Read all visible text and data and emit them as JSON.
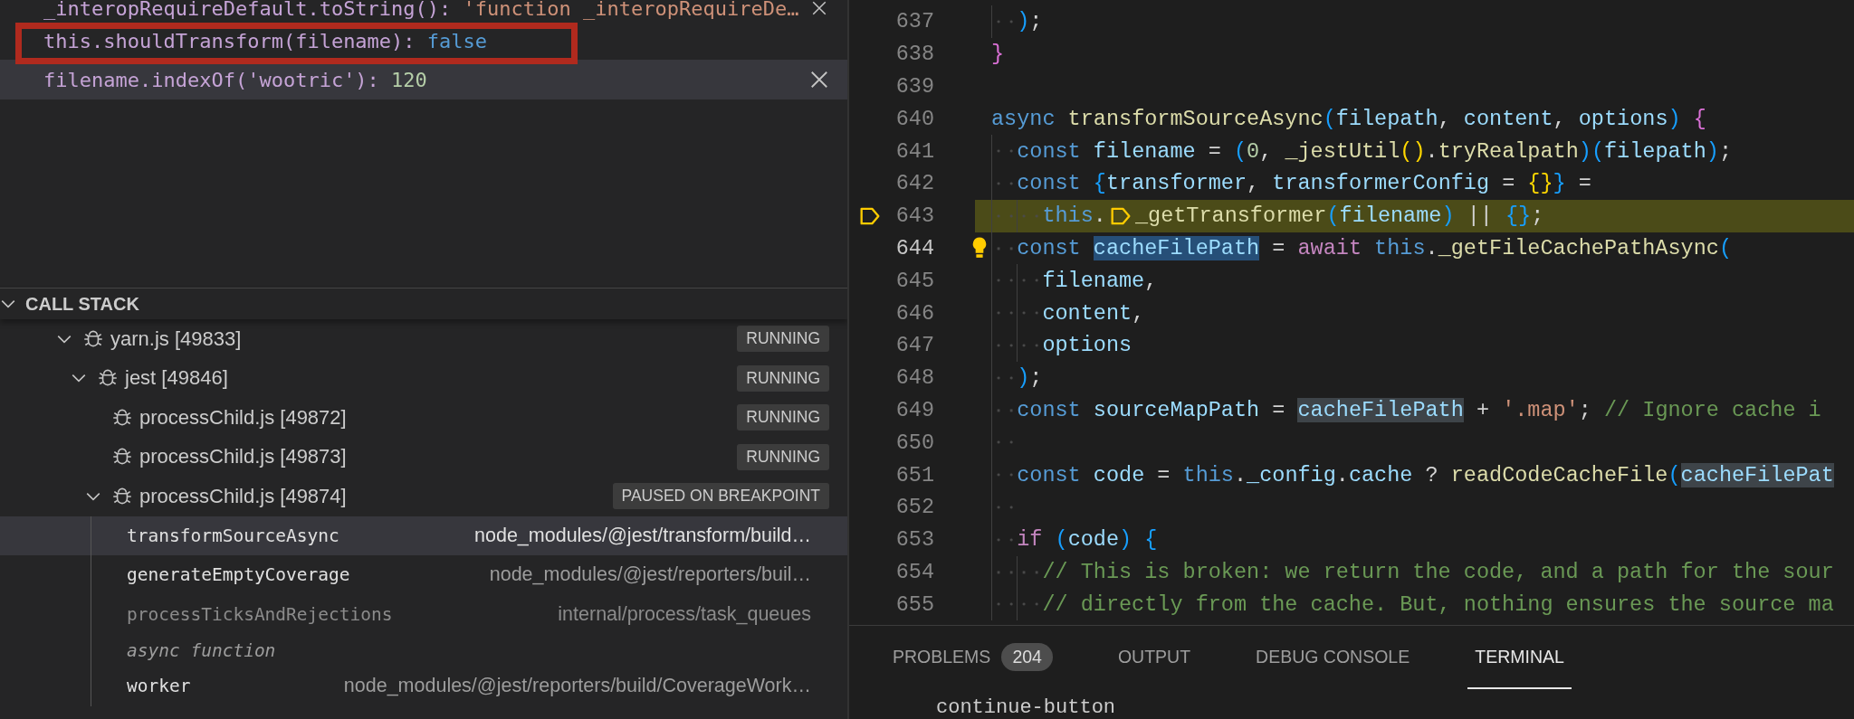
{
  "watch": {
    "annotation": {
      "kind": "outline"
    },
    "items": [
      {
        "expression": "_interopRequireDefault.toString():",
        "value": "'function _interopRequireDe…",
        "kind": "string",
        "selected": false,
        "close_button": true
      },
      {
        "expression": "this.shouldTransform(filename):",
        "value": "false",
        "kind": "boolean",
        "selected": false,
        "close_button": false
      },
      {
        "expression": "filename.indexOf('wootric'):",
        "value": "120",
        "kind": "number",
        "selected": true,
        "close_button": true
      }
    ]
  },
  "call_stack": {
    "title": "CALL STACK",
    "expanded": true,
    "items": [
      {
        "kind": "session",
        "label": "yarn.js [49833]",
        "status": "RUNNING",
        "expanded": true,
        "children": [
          {
            "kind": "session",
            "label": "jest [49846]",
            "status": "RUNNING",
            "expanded": true,
            "children": [
              {
                "kind": "session",
                "label": "processChild.js [49872]",
                "status": "RUNNING"
              },
              {
                "kind": "session",
                "label": "processChild.js [49873]",
                "status": "RUNNING"
              },
              {
                "kind": "session",
                "label": "processChild.js [49874]",
                "status": "PAUSED ON BREAKPOINT",
                "expanded": true,
                "children": [
                  {
                    "kind": "frame",
                    "name": "transformSourceAsync",
                    "source": "node_modules/@jest/transform/build…",
                    "selected": true,
                    "dimmed": false
                  },
                  {
                    "kind": "frame",
                    "name": "generateEmptyCoverage",
                    "source": "node_modules/@jest/reporters/buil…",
                    "selected": false,
                    "dimmed": false
                  },
                  {
                    "kind": "frame",
                    "name": "processTicksAndRejections",
                    "source": "internal/process/task_queues",
                    "selected": false,
                    "dimmed": true
                  },
                  {
                    "kind": "label",
                    "text": "async function"
                  },
                  {
                    "kind": "frame",
                    "name": "worker",
                    "source": "node_modules/@jest/reporters/build/CoverageWork…",
                    "selected": false,
                    "dimmed": false
                  }
                ]
              }
            ]
          }
        ]
      }
    ]
  },
  "editor": {
    "lines": [
      {
        "children": [
          {
            "number": "637",
            "kind": "code",
            "tokens": [
              {
                "kind": "b3",
                "text": ")"
              },
              {
                "kind": "op",
                "text": ";"
              }
            ]
          }
        ]
      },
      {
        "number": "638",
        "kind": "code",
        "tokens": [
          {
            "kind": "b2",
            "text": "}"
          }
        ]
      },
      {
        "number": "639",
        "kind": "code"
      },
      {
        "number": "640",
        "kind": "code",
        "tokens": [
          {
            "kind": "kw",
            "text": "async"
          },
          {
            "kind": "fn",
            "text": " transformSourceAsync"
          },
          {
            "kind": "b3",
            "text": "("
          },
          {
            "kind": "var",
            "text": "filepath"
          },
          {
            "kind": "op",
            "text": ", "
          },
          {
            "kind": "var",
            "text": "content"
          },
          {
            "kind": "op",
            "text": ", "
          },
          {
            "kind": "var",
            "text": "options"
          },
          {
            "kind": "b3",
            "text": ")"
          },
          {
            "kind": "b2",
            "text": " {"
          }
        ],
        "children": [
          {
            "number": "641",
            "kind": "code",
            "tokens": [
              {
                "kind": "kw",
                "text": "const"
              },
              {
                "kind": "var",
                "text": " filename"
              },
              {
                "kind": "op",
                "text": " = "
              },
              {
                "kind": "b3",
                "text": "("
              },
              {
                "kind": "num",
                "text": "0"
              },
              {
                "kind": "op",
                "text": ", "
              },
              {
                "kind": "fn",
                "text": "_jestUtil"
              },
              {
                "kind": "b1",
                "text": "()"
              },
              {
                "kind": "op",
                "text": "."
              },
              {
                "kind": "fn",
                "text": "tryRealpath"
              },
              {
                "kind": "b3",
                "text": ")("
              },
              {
                "kind": "var",
                "text": "filepath"
              },
              {
                "kind": "b3",
                "text": ")"
              },
              {
                "kind": "op",
                "text": ";"
              }
            ]
          },
          {
            "number": "642",
            "kind": "code",
            "tokens": [
              {
                "kind": "kw",
                "text": "const"
              },
              {
                "kind": "b3",
                "text": " {"
              },
              {
                "kind": "var",
                "text": "transformer"
              },
              {
                "kind": "op",
                "text": ", "
              },
              {
                "kind": "var",
                "text": "transformerConfig"
              },
              {
                "kind": "op",
                "text": " = "
              },
              {
                "kind": "b1",
                "text": "{}"
              },
              {
                "kind": "b3",
                "text": "}"
              },
              {
                "kind": "op",
                "text": " ="
              }
            ],
            "children": [
              {
                "number": "643",
                "kind": "paused",
                "tokens": [
                  {
                    "kind": "kw",
                    "text": "this"
                  },
                  {
                    "kind": "op",
                    "text": "."
                  },
                  {
                    "kind": "marker"
                  },
                  {
                    "kind": "fn",
                    "text": "_getTransformer"
                  },
                  {
                    "kind": "b3",
                    "text": "("
                  },
                  {
                    "kind": "var",
                    "text": "filename"
                  },
                  {
                    "kind": "b3",
                    "text": ")"
                  },
                  {
                    "kind": "op",
                    "text": " || "
                  },
                  {
                    "kind": "b3",
                    "text": "{}"
                  },
                  {
                    "kind": "op",
                    "text": ";"
                  }
                ]
              }
            ]
          },
          {
            "number": "644",
            "kind": "hint",
            "tokens": [
              {
                "kind": "kw",
                "text": "const "
              },
              {
                "kind": "selection",
                "text": "cacheFilePath"
              },
              {
                "kind": "op",
                "text": " = "
              },
              {
                "kind": "ctrl",
                "text": "await"
              },
              {
                "kind": "kw",
                "text": " this"
              },
              {
                "kind": "op",
                "text": "."
              },
              {
                "kind": "fn",
                "text": "_getFileCachePathAsync"
              },
              {
                "kind": "b3",
                "text": "("
              }
            ],
            "children": [
              {
                "number": "645",
                "kind": "code",
                "tokens": [
                  {
                    "kind": "var",
                    "text": "filename"
                  },
                  {
                    "kind": "op",
                    "text": ","
                  }
                ]
              },
              {
                "number": "646",
                "kind": "code",
                "tokens": [
                  {
                    "kind": "var",
                    "text": "content"
                  },
                  {
                    "kind": "op",
                    "text": ","
                  }
                ]
              },
              {
                "number": "647",
                "kind": "code",
                "tokens": [
                  {
                    "kind": "var",
                    "text": "options"
                  }
                ]
              }
            ]
          },
          {
            "number": "648",
            "kind": "code",
            "tokens": [
              {
                "kind": "b3",
                "text": ")"
              },
              {
                "kind": "op",
                "text": ";"
              }
            ]
          },
          {
            "number": "649",
            "kind": "code",
            "tokens": [
              {
                "kind": "kw",
                "text": "const"
              },
              {
                "kind": "var",
                "text": " sourceMapPath"
              },
              {
                "kind": "op",
                "text": " = "
              },
              {
                "kind": "occurrence",
                "text": "cacheFilePath"
              },
              {
                "kind": "op",
                "text": " + "
              },
              {
                "kind": "str",
                "text": "'.map'"
              },
              {
                "kind": "op",
                "text": "; "
              },
              {
                "kind": "cmt",
                "text": "// Ignore cache i"
              }
            ]
          },
          {
            "number": "650",
            "kind": "code"
          },
          {
            "number": "651",
            "kind": "code",
            "tokens": [
              {
                "kind": "kw",
                "text": "const"
              },
              {
                "kind": "var",
                "text": " code"
              },
              {
                "kind": "op",
                "text": " = "
              },
              {
                "kind": "kw",
                "text": "this"
              },
              {
                "kind": "op",
                "text": "."
              },
              {
                "kind": "var",
                "text": "_config"
              },
              {
                "kind": "op",
                "text": "."
              },
              {
                "kind": "var",
                "text": "cache"
              },
              {
                "kind": "op",
                "text": " ? "
              },
              {
                "kind": "fn",
                "text": "readCodeCacheFile"
              },
              {
                "kind": "b3",
                "text": "("
              },
              {
                "kind": "occurrence",
                "text": "cacheFilePat"
              }
            ]
          },
          {
            "number": "652",
            "kind": "code"
          },
          {
            "number": "653",
            "kind": "code",
            "tokens": [
              {
                "kind": "ctrl",
                "text": "if"
              },
              {
                "kind": "b3",
                "text": " ("
              },
              {
                "kind": "var",
                "text": "code"
              },
              {
                "kind": "b3",
                "text": ")"
              },
              {
                "kind": "b3",
                "text": " {"
              }
            ],
            "children": [
              {
                "number": "654",
                "kind": "code",
                "tokens": [
                  {
                    "kind": "cmt",
                    "text": "// This is broken: we return the code, and a path for the sour"
                  }
                ]
              },
              {
                "number": "655",
                "kind": "code",
                "tokens": [
                  {
                    "kind": "cmt",
                    "text": "// directly from the cache. But, nothing ensures the source ma"
                  }
                ]
              }
            ]
          }
        ]
      }
    ]
  },
  "panel": {
    "tabs": [
      {
        "label": "PROBLEMS",
        "badge": "204",
        "selected": false
      },
      {
        "label": "OUTPUT",
        "selected": false
      },
      {
        "label": "DEBUG CONSOLE",
        "selected": false
      },
      {
        "label": "TERMINAL",
        "selected": true
      }
    ],
    "terminal_lines": [
      "continue-button"
    ]
  }
}
